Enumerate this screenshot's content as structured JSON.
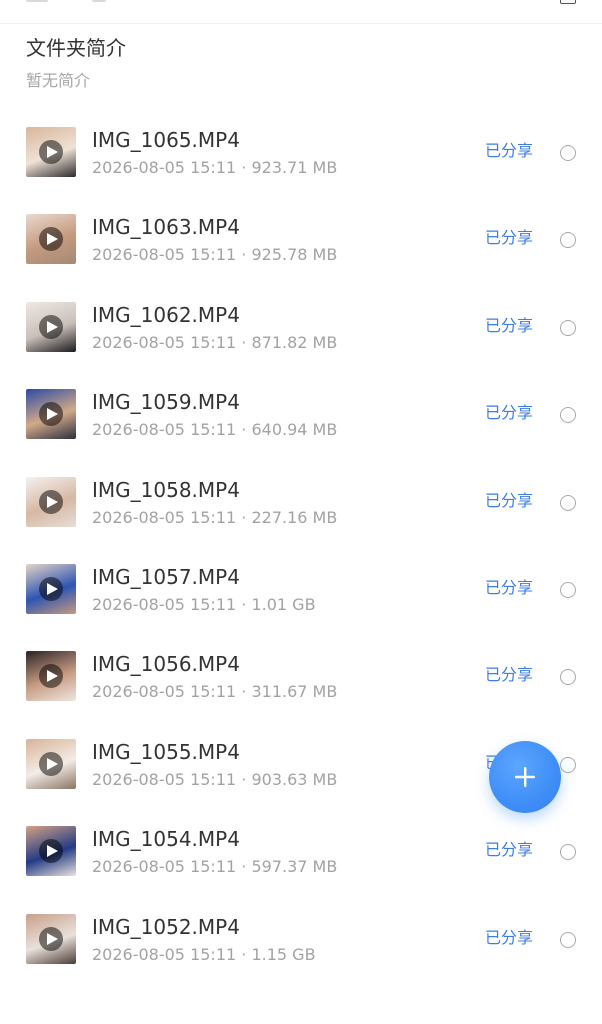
{
  "folder": {
    "title": "文件夹简介",
    "description": "暂无简介"
  },
  "files": [
    {
      "name": "IMG_1065.MP4",
      "date": "2026-08-05 15:11",
      "size": "923.71 MB",
      "status": "已分享",
      "thumb_colors": [
        "#d8b69c",
        "#efe2d6",
        "#2d2a2b"
      ]
    },
    {
      "name": "IMG_1063.MP4",
      "date": "2026-08-05 15:11",
      "size": "925.78 MB",
      "status": "已分享",
      "thumb_colors": [
        "#e8d9cf",
        "#c59a7e",
        "#a48977"
      ]
    },
    {
      "name": "IMG_1062.MP4",
      "date": "2026-08-05 15:11",
      "size": "871.82 MB",
      "status": "已分享",
      "thumb_colors": [
        "#efe8e3",
        "#c9c0b9",
        "#1b1a1d"
      ]
    },
    {
      "name": "IMG_1059.MP4",
      "date": "2026-08-05 15:11",
      "size": "640.94 MB",
      "status": "已分享",
      "thumb_colors": [
        "#2c4aa3",
        "#d1a989",
        "#2b2e3e"
      ]
    },
    {
      "name": "IMG_1058.MP4",
      "date": "2026-08-05 15:11",
      "size": "227.16 MB",
      "status": "已分享",
      "thumb_colors": [
        "#f4f1ef",
        "#d7b8a3",
        "#e6ddd6"
      ]
    },
    {
      "name": "IMG_1057.MP4",
      "date": "2026-08-05 15:11",
      "size": "1.01 GB",
      "status": "已分享",
      "thumb_colors": [
        "#e4d5c7",
        "#2e55b3",
        "#c79a7d"
      ]
    },
    {
      "name": "IMG_1056.MP4",
      "date": "2026-08-05 15:11",
      "size": "311.67 MB",
      "status": "已分享",
      "thumb_colors": [
        "#2b2425",
        "#c89c83",
        "#efe6e0"
      ]
    },
    {
      "name": "IMG_1055.MP4",
      "date": "2026-08-05 15:11",
      "size": "903.63 MB",
      "status": "已分享",
      "thumb_colors": [
        "#d8b398",
        "#f3ece6",
        "#8c7362"
      ]
    },
    {
      "name": "IMG_1054.MP4",
      "date": "2026-08-05 15:11",
      "size": "597.37 MB",
      "status": "已分享",
      "thumb_colors": [
        "#d3a184",
        "#233c86",
        "#eae2dc"
      ]
    },
    {
      "name": "IMG_1052.MP4",
      "date": "2026-08-05 15:11",
      "size": "1.15 GB",
      "status": "已分享",
      "thumb_colors": [
        "#c8a08a",
        "#e9e1db",
        "#4b3b35"
      ]
    }
  ],
  "separator": " · ",
  "fab": {
    "icon": "plus-icon"
  },
  "colors": {
    "accent": "#3d7ee6",
    "fab": "#3f8ef7"
  }
}
